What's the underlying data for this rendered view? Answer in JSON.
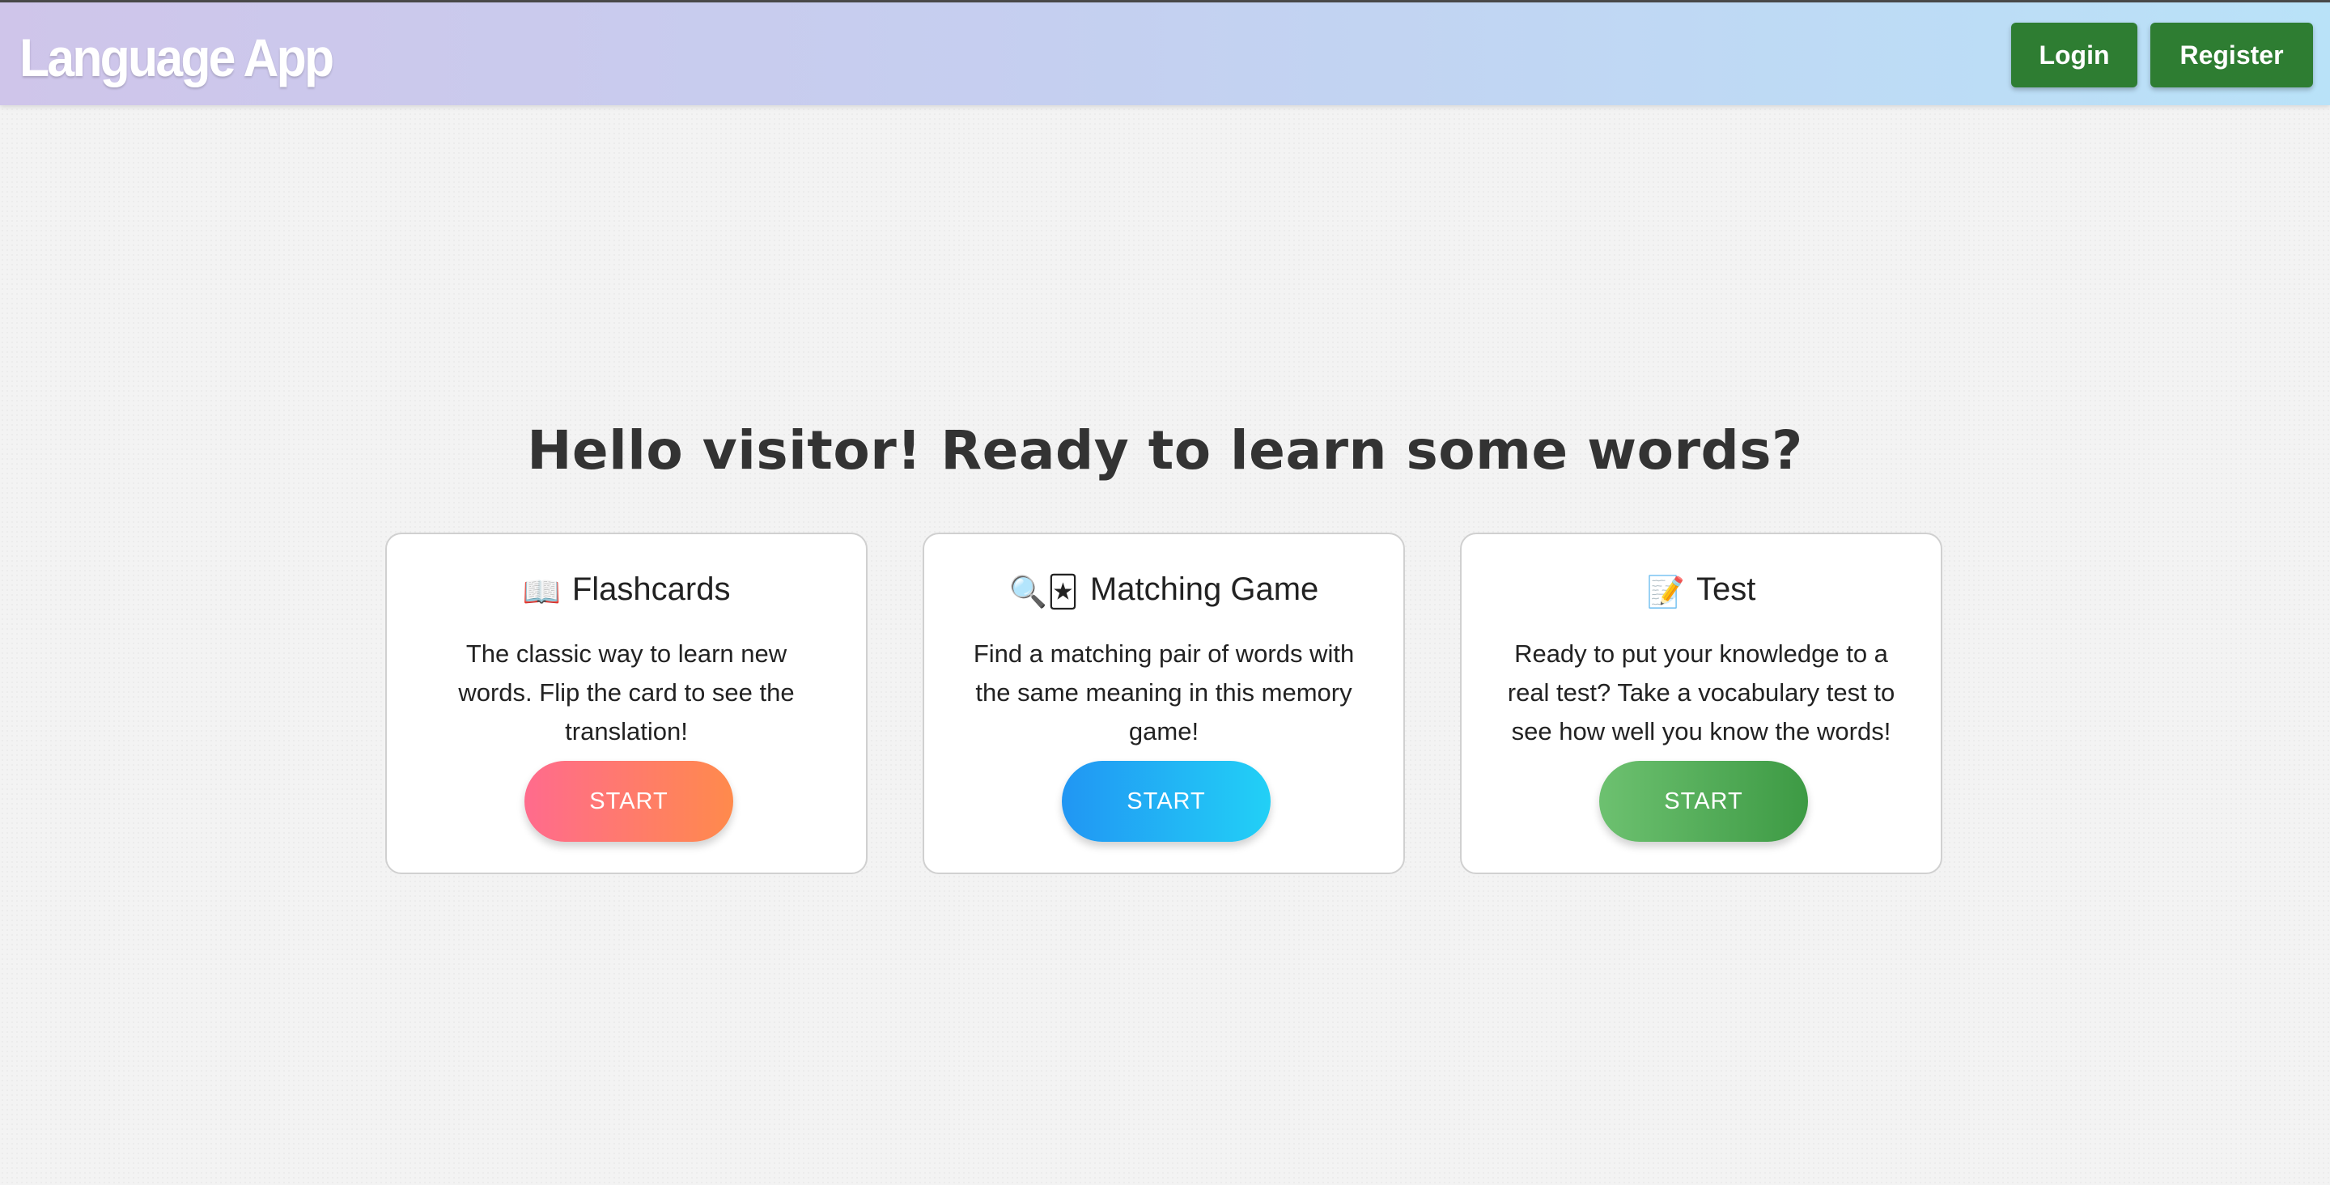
{
  "app": {
    "brand": "Language App"
  },
  "nav": {
    "login_label": "Login",
    "register_label": "Register",
    "button_color": "#2e7d32"
  },
  "main": {
    "headline": "Hello visitor! Ready to learn some words?"
  },
  "cards": [
    {
      "icon": "open-book-icon",
      "icon_glyph": "📖",
      "title": "Flashcards",
      "description": "The classic way to learn new words. Flip the card to see the translation!",
      "button_label": "START",
      "accent": "#ff7a6a"
    },
    {
      "icon": "magnifier-and-cards-icon",
      "icon_glyph": "🔍🃏",
      "title": "Matching Game",
      "description": "Find a matching pair of words with the same meaning in this memory game!",
      "button_label": "START",
      "accent": "#21b3f5"
    },
    {
      "icon": "memo-pencil-icon",
      "icon_glyph": "📝",
      "title": "Test",
      "description": "Ready to put your knowledge to a real test? Take a vocabulary test to see how well you know the words!",
      "button_label": "START",
      "accent": "#4caf50"
    }
  ]
}
